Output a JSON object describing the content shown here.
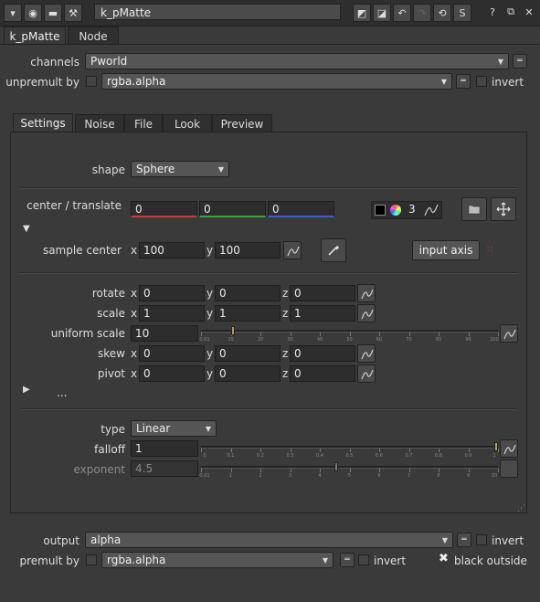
{
  "node_name": "k_pMatte",
  "tabs": [
    "k_pMatte",
    "Node"
  ],
  "subtabs": [
    "Settings",
    "Noise",
    "File",
    "Look",
    "Preview"
  ],
  "channels": {
    "label": "channels",
    "value": "Pworld"
  },
  "unpremult": {
    "label": "unpremult by",
    "value": "rgba.alpha",
    "invert_label": "invert"
  },
  "shape": {
    "label": "shape",
    "value": "Sphere"
  },
  "center": {
    "label": "center / translate",
    "values": [
      "0",
      "0",
      "0"
    ],
    "count": "3"
  },
  "sample_center": {
    "label": "sample center",
    "x_label": "x",
    "y_label": "y",
    "x": "100",
    "y": "100",
    "input_axis": "input axis"
  },
  "rotate": {
    "label": "rotate",
    "x": "0",
    "y": "0",
    "z": "0"
  },
  "scale": {
    "label": "scale",
    "x": "1",
    "y": "1",
    "z": "1"
  },
  "uniform_scale": {
    "label": "uniform scale",
    "value": "10",
    "level": 10,
    "ticks": [
      "0.01",
      "10",
      "20",
      "30",
      "40",
      "50",
      "60",
      "70",
      "80",
      "90",
      "100"
    ]
  },
  "skew": {
    "label": "skew",
    "x": "0",
    "y": "0",
    "z": "0"
  },
  "pivot": {
    "label": "pivot",
    "x": "0",
    "y": "0",
    "z": "0"
  },
  "ellipsis": "...",
  "type": {
    "label": "type",
    "value": "Linear"
  },
  "falloff": {
    "label": "falloff",
    "value": "1",
    "level": 1,
    "ticks": [
      "0",
      "0.1",
      "0.2",
      "0.3",
      "0.4",
      "0.5",
      "0.6",
      "0.7",
      "0.8",
      "0.9",
      "1"
    ]
  },
  "exponent": {
    "label": "exponent",
    "value": "4.5",
    "level": 4.5,
    "ticks": [
      "0.01",
      "1",
      "2",
      "3",
      "4",
      "5",
      "6",
      "7",
      "8",
      "9",
      "10"
    ]
  },
  "output": {
    "label": "output",
    "value": "alpha",
    "invert_label": "invert"
  },
  "premult": {
    "label": "premult by",
    "value": "rgba.alpha",
    "invert_label": "invert",
    "black_outside_label": "black outside"
  },
  "colors": {
    "x_underline": "#c04040",
    "y_underline": "#40a040",
    "z_underline": "#4060c0",
    "knob": "#b89a55"
  }
}
